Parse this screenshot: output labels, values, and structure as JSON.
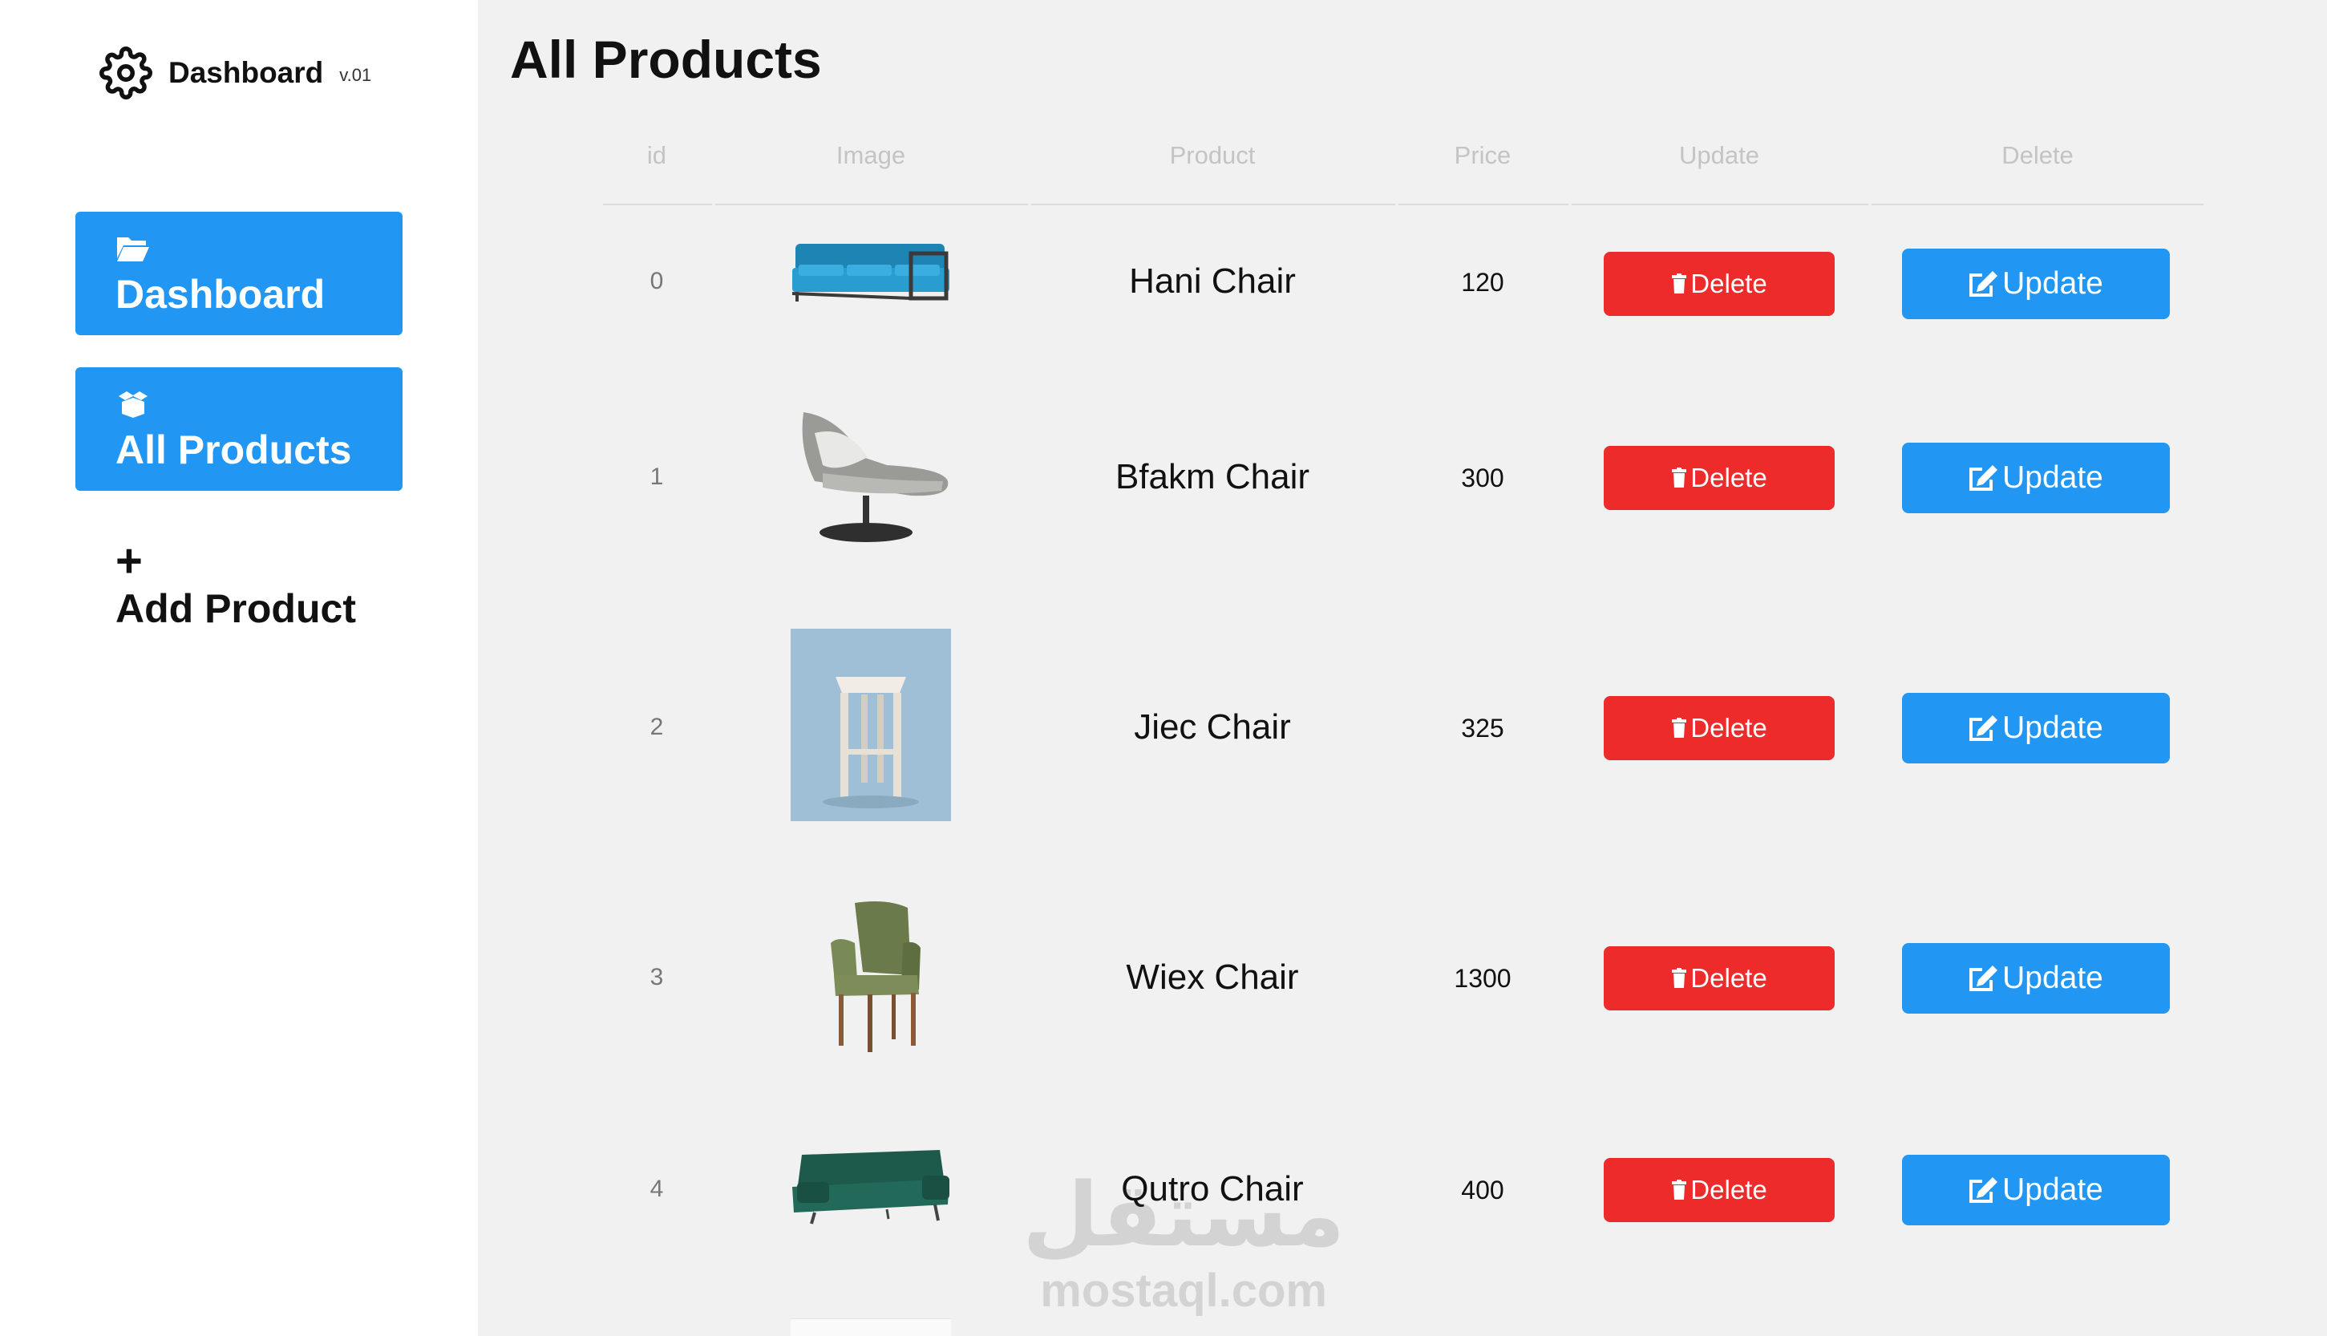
{
  "brand": {
    "title": "Dashboard",
    "version": "v.01",
    "icon": "gear-icon"
  },
  "sidebar": {
    "items": [
      {
        "label": "Dashboard",
        "icon": "folder-open-icon",
        "active": true
      },
      {
        "label": "All Products",
        "icon": "box-open-icon",
        "active": true
      },
      {
        "label": "Add Product",
        "icon": "plus-icon",
        "active": false
      }
    ]
  },
  "page": {
    "title": "All Products"
  },
  "table": {
    "headers": [
      "id",
      "Image",
      "Product",
      "Price",
      "Update",
      "Delete"
    ],
    "rows": [
      {
        "id": "0",
        "name": "Hani Chair",
        "price": "120",
        "image": "blue-sofa"
      },
      {
        "id": "1",
        "name": "Bfakm Chair",
        "price": "300",
        "image": "grey-lounge-chair"
      },
      {
        "id": "2",
        "name": "Jiec Chair",
        "price": "325",
        "image": "wooden-stool"
      },
      {
        "id": "3",
        "name": "Wiex Chair",
        "price": "1300",
        "image": "green-armchair"
      },
      {
        "id": "4",
        "name": "Qutro Chair",
        "price": "400",
        "image": "green-sofa"
      }
    ],
    "delete_label": "Delete",
    "update_label": "Update"
  },
  "colors": {
    "primary": "#2196f3",
    "danger": "#ee2b2b",
    "background": "#f0f1f0",
    "sidebar": "#ffffff"
  },
  "watermark": {
    "arabic": "مستقل",
    "latin": "mostaql.com"
  }
}
